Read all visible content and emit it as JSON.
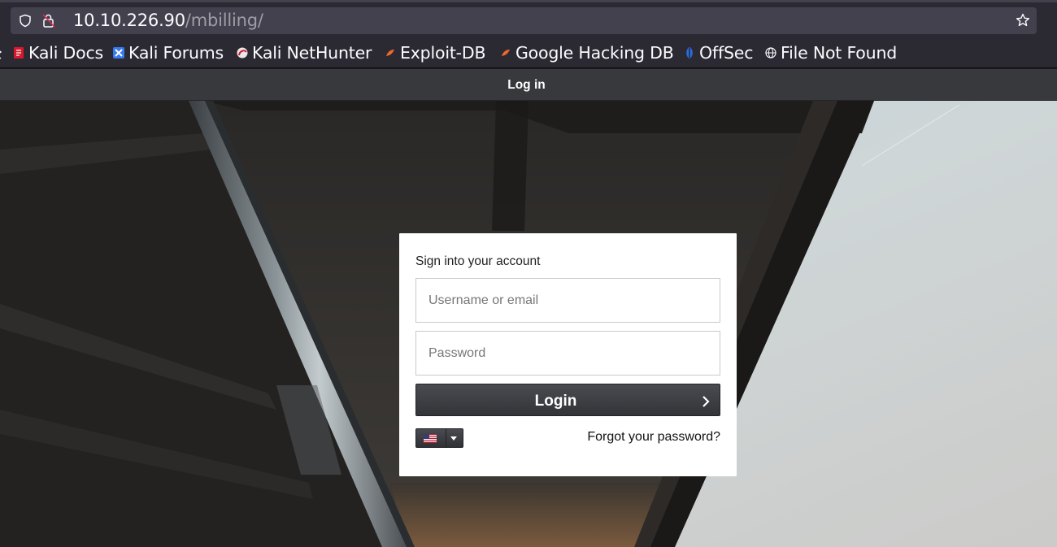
{
  "browser": {
    "url_host": "10.10.226.90",
    "url_path": "/mbilling/",
    "bookmarks": [
      {
        "label": "Kali Docs",
        "icon": "kali-docs-icon"
      },
      {
        "label": "Kali Forums",
        "icon": "kali-forums-icon"
      },
      {
        "label": "Kali NetHunter",
        "icon": "kali-nethunter-icon"
      },
      {
        "label": "Exploit-DB",
        "icon": "exploit-db-icon"
      },
      {
        "label": "Google Hacking DB",
        "icon": "google-hacking-db-icon"
      },
      {
        "label": "OffSec",
        "icon": "offsec-icon"
      },
      {
        "label": "File Not Found",
        "icon": "globe-icon"
      }
    ]
  },
  "header": {
    "title": "Log in"
  },
  "login": {
    "heading": "Sign into your account",
    "username_placeholder": "Username or email",
    "password_placeholder": "Password",
    "login_label": "Login",
    "language_flag": "us-flag-icon",
    "forgot_label": "Forgot your password?"
  },
  "colors": {
    "header_bg": "#38393d",
    "button_bg": "#3c3d41",
    "card_bg": "#ffffff"
  }
}
